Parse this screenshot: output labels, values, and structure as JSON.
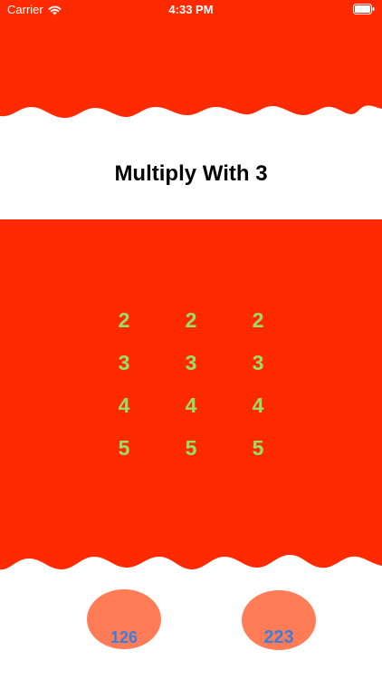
{
  "status_bar": {
    "carrier": "Carrier",
    "time": "4:33 PM",
    "wifi_icon": "wifi-icon",
    "battery_icon": "battery-icon"
  },
  "colors": {
    "banner_red": "#ff2a00",
    "number_green": "#98df68",
    "bubble_orange": "#ff7c57",
    "answer_blue": "#3b7ddd"
  },
  "title": "Multiply With 3",
  "grid": {
    "rows": [
      [
        "2",
        "2",
        "2"
      ],
      [
        "3",
        "3",
        "3"
      ],
      [
        "4",
        "4",
        "4"
      ],
      [
        "5",
        "5",
        "5"
      ]
    ]
  },
  "answers": [
    {
      "value": "126"
    },
    {
      "value": "223"
    }
  ]
}
